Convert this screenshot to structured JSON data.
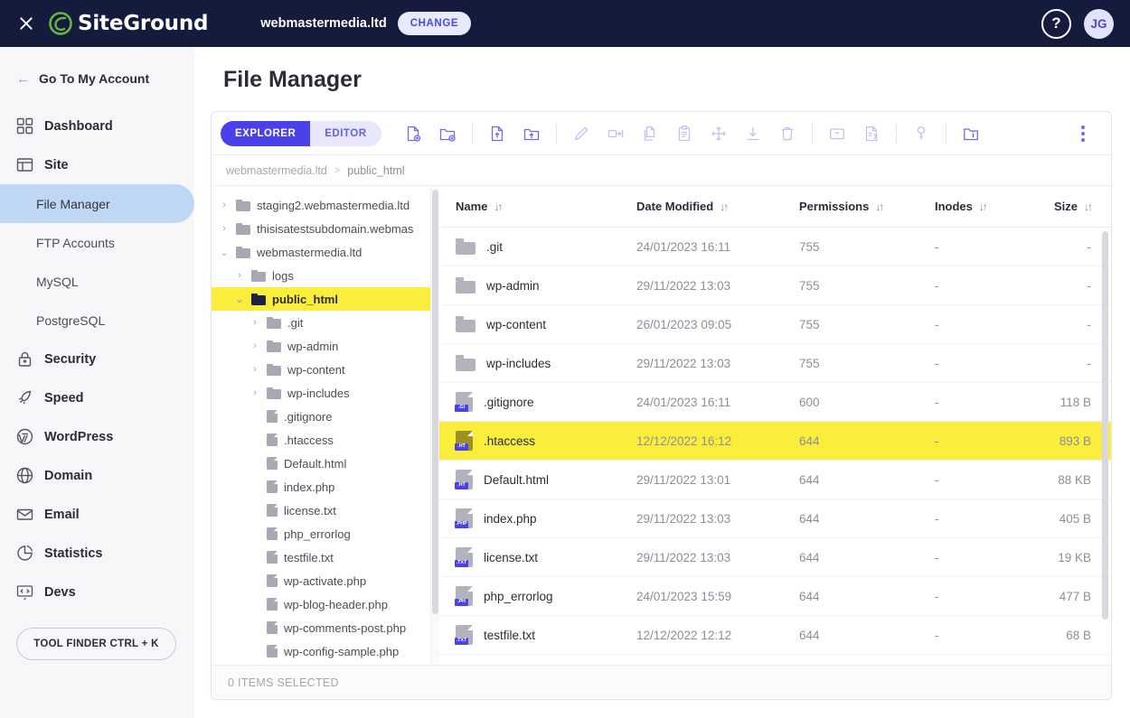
{
  "topbar": {
    "close_icon": "close-icon",
    "brand": "SiteGround",
    "site_name": "webmastermedia.ltd",
    "change_label": "CHANGE",
    "help_label": "?",
    "avatar_initials": "JG"
  },
  "sidebar": {
    "back_label": "Go To My Account",
    "items": [
      {
        "label": "Dashboard",
        "icon": "grid-icon",
        "active": false
      },
      {
        "label": "Site",
        "icon": "browser-icon",
        "active": false
      },
      {
        "label": "Security",
        "icon": "lock-icon",
        "active": false
      },
      {
        "label": "Speed",
        "icon": "rocket-icon",
        "active": false
      },
      {
        "label": "WordPress",
        "icon": "wordpress-icon",
        "active": false
      },
      {
        "label": "Domain",
        "icon": "globe-icon",
        "active": false
      },
      {
        "label": "Email",
        "icon": "envelope-icon",
        "active": false
      },
      {
        "label": "Statistics",
        "icon": "pie-chart-icon",
        "active": false
      },
      {
        "label": "Devs",
        "icon": "code-monitor-icon",
        "active": false
      }
    ],
    "site_subitems": [
      {
        "label": "File Manager",
        "active": true
      },
      {
        "label": "FTP Accounts",
        "active": false
      },
      {
        "label": "MySQL",
        "active": false
      },
      {
        "label": "PostgreSQL",
        "active": false
      }
    ],
    "tool_finder_label": "TOOL FINDER CTRL + K"
  },
  "page": {
    "title": "File Manager"
  },
  "toolbar": {
    "segments": [
      {
        "label": "EXPLORER",
        "active": true
      },
      {
        "label": "EDITOR",
        "active": false
      }
    ],
    "buttons": [
      {
        "name": "new-file-icon",
        "enabled": true
      },
      {
        "name": "new-folder-icon",
        "enabled": true
      },
      {
        "name": "upload-file-icon",
        "enabled": true
      },
      {
        "name": "upload-folder-icon",
        "enabled": true
      },
      {
        "name": "edit-pencil-icon",
        "enabled": false
      },
      {
        "name": "rename-icon",
        "enabled": false
      },
      {
        "name": "copy-icon",
        "enabled": false
      },
      {
        "name": "paste-icon",
        "enabled": false
      },
      {
        "name": "move-icon",
        "enabled": false
      },
      {
        "name": "download-icon",
        "enabled": false
      },
      {
        "name": "delete-trash-icon",
        "enabled": false
      },
      {
        "name": "archive-icon",
        "enabled": false
      },
      {
        "name": "extract-icon",
        "enabled": false
      },
      {
        "name": "permissions-key-icon",
        "enabled": false
      },
      {
        "name": "folder-info-icon",
        "enabled": true
      },
      {
        "name": "more-kebab-icon",
        "enabled": true
      }
    ]
  },
  "breadcrumb": {
    "root": "webmastermedia.ltd",
    "separator": ">",
    "current": "public_html"
  },
  "tree": {
    "nodes": [
      {
        "label": "staging2.webmastermedia.ltd",
        "type": "folder",
        "indent": 0,
        "twisty": "collapsed",
        "selected": false
      },
      {
        "label": "thisisatestsubdomain.webmas",
        "type": "folder",
        "indent": 0,
        "twisty": "collapsed",
        "selected": false
      },
      {
        "label": "webmastermedia.ltd",
        "type": "folder",
        "indent": 0,
        "twisty": "expanded",
        "selected": false
      },
      {
        "label": "logs",
        "type": "folder",
        "indent": 1,
        "twisty": "collapsed",
        "selected": false
      },
      {
        "label": "public_html",
        "type": "folder",
        "indent": 1,
        "twisty": "expanded",
        "selected": true
      },
      {
        "label": ".git",
        "type": "folder",
        "indent": 2,
        "twisty": "collapsed",
        "selected": false
      },
      {
        "label": "wp-admin",
        "type": "folder",
        "indent": 2,
        "twisty": "collapsed",
        "selected": false
      },
      {
        "label": "wp-content",
        "type": "folder",
        "indent": 2,
        "twisty": "collapsed",
        "selected": false
      },
      {
        "label": "wp-includes",
        "type": "folder",
        "indent": 2,
        "twisty": "collapsed",
        "selected": false
      },
      {
        "label": ".gitignore",
        "type": "file",
        "indent": 2,
        "twisty": "none",
        "selected": false
      },
      {
        "label": ".htaccess",
        "type": "file",
        "indent": 2,
        "twisty": "none",
        "selected": false
      },
      {
        "label": "Default.html",
        "type": "file",
        "indent": 2,
        "twisty": "none",
        "selected": false
      },
      {
        "label": "index.php",
        "type": "file",
        "indent": 2,
        "twisty": "none",
        "selected": false
      },
      {
        "label": "license.txt",
        "type": "file",
        "indent": 2,
        "twisty": "none",
        "selected": false
      },
      {
        "label": "php_errorlog",
        "type": "file",
        "indent": 2,
        "twisty": "none",
        "selected": false
      },
      {
        "label": "testfile.txt",
        "type": "file",
        "indent": 2,
        "twisty": "none",
        "selected": false
      },
      {
        "label": "wp-activate.php",
        "type": "file",
        "indent": 2,
        "twisty": "none",
        "selected": false
      },
      {
        "label": "wp-blog-header.php",
        "type": "file",
        "indent": 2,
        "twisty": "none",
        "selected": false
      },
      {
        "label": "wp-comments-post.php",
        "type": "file",
        "indent": 2,
        "twisty": "none",
        "selected": false
      },
      {
        "label": "wp-config-sample.php",
        "type": "file",
        "indent": 2,
        "twisty": "none",
        "selected": false
      },
      {
        "label": "",
        "type": "file",
        "indent": 2,
        "twisty": "none",
        "selected": false
      }
    ]
  },
  "table": {
    "columns": [
      {
        "label": "Name",
        "sortable": true
      },
      {
        "label": "Date Modified",
        "sortable": true
      },
      {
        "label": "Permissions",
        "sortable": true
      },
      {
        "label": "Inodes",
        "sortable": true
      },
      {
        "label": "Size",
        "sortable": true
      }
    ],
    "rows": [
      {
        "name": ".git",
        "type": "folder",
        "ext": "",
        "date": "24/01/2023 16:11",
        "permissions": "755",
        "inodes": "-",
        "size": "-",
        "highlighted": false
      },
      {
        "name": "wp-admin",
        "type": "folder",
        "ext": "",
        "date": "29/11/2022 13:03",
        "permissions": "755",
        "inodes": "-",
        "size": "-",
        "highlighted": false
      },
      {
        "name": "wp-content",
        "type": "folder",
        "ext": "",
        "date": "26/01/2023 09:05",
        "permissions": "755",
        "inodes": "-",
        "size": "-",
        "highlighted": false
      },
      {
        "name": "wp-includes",
        "type": "folder",
        "ext": "",
        "date": "29/11/2022 13:03",
        "permissions": "755",
        "inodes": "-",
        "size": "-",
        "highlighted": false
      },
      {
        "name": ".gitignore",
        "type": "file",
        "ext": ".GI",
        "date": "24/01/2023 16:11",
        "permissions": "600",
        "inodes": "-",
        "size": "118 B",
        "highlighted": false
      },
      {
        "name": ".htaccess",
        "type": "file",
        "ext": ".HT",
        "date": "12/12/2022 16:12",
        "permissions": "644",
        "inodes": "-",
        "size": "893 B",
        "highlighted": true
      },
      {
        "name": "Default.html",
        "type": "file",
        "ext": ".HT",
        "date": "29/11/2022 13:01",
        "permissions": "644",
        "inodes": "-",
        "size": "88 KB",
        "highlighted": false
      },
      {
        "name": "index.php",
        "type": "file",
        "ext": ".PHP",
        "date": "29/11/2022 13:03",
        "permissions": "644",
        "inodes": "-",
        "size": "405 B",
        "highlighted": false
      },
      {
        "name": "license.txt",
        "type": "file",
        "ext": ".TXT",
        "date": "29/11/2022 13:03",
        "permissions": "644",
        "inodes": "-",
        "size": "19 KB",
        "highlighted": false
      },
      {
        "name": "php_errorlog",
        "type": "file",
        "ext": ".PH",
        "date": "24/01/2023 15:59",
        "permissions": "644",
        "inodes": "-",
        "size": "477 B",
        "highlighted": false
      },
      {
        "name": "testfile.txt",
        "type": "file",
        "ext": ".TXT",
        "date": "12/12/2022 12:12",
        "permissions": "644",
        "inodes": "-",
        "size": "68 B",
        "highlighted": false
      }
    ]
  },
  "statusbar": {
    "text": "0 ITEMS SELECTED"
  },
  "colors": {
    "topbar_bg": "#151b3d",
    "accent_indigo": "#4a41e8",
    "highlight_yellow": "#fbed3c",
    "active_nav_blue": "#bfd7f5",
    "brand_green": "#6cb33f"
  }
}
